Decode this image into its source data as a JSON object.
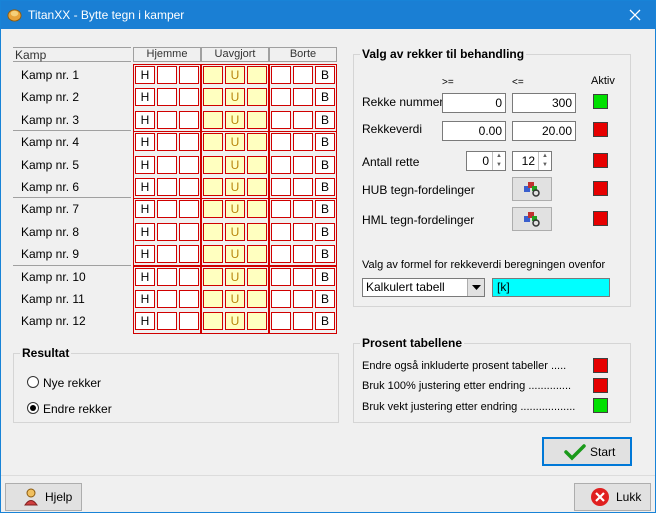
{
  "window": {
    "title": "TitanXX - Bytte tegn i kamper"
  },
  "grid": {
    "header_kamp": "Kamp",
    "groups": [
      "Hjemme",
      "Uavgjort",
      "Borte"
    ],
    "matches": [
      {
        "label": "Kamp nr. 1",
        "h": "H",
        "u": "U",
        "b": "B"
      },
      {
        "label": "Kamp nr. 2",
        "h": "H",
        "u": "U",
        "b": "B"
      },
      {
        "label": "Kamp nr. 3",
        "h": "H",
        "u": "U",
        "b": "B"
      },
      {
        "label": "Kamp nr. 4",
        "h": "H",
        "u": "U",
        "b": "B"
      },
      {
        "label": "Kamp nr. 5",
        "h": "H",
        "u": "U",
        "b": "B"
      },
      {
        "label": "Kamp nr. 6",
        "h": "H",
        "u": "U",
        "b": "B"
      },
      {
        "label": "Kamp nr. 7",
        "h": "H",
        "u": "U",
        "b": "B"
      },
      {
        "label": "Kamp nr. 8",
        "h": "H",
        "u": "U",
        "b": "B"
      },
      {
        "label": "Kamp nr. 9",
        "h": "H",
        "u": "U",
        "b": "B"
      },
      {
        "label": "Kamp nr. 10",
        "h": "H",
        "u": "U",
        "b": "B"
      },
      {
        "label": "Kamp nr. 11",
        "h": "H",
        "u": "U",
        "b": "B"
      },
      {
        "label": "Kamp nr. 12",
        "h": "H",
        "u": "U",
        "b": "B"
      }
    ]
  },
  "valg": {
    "title": "Valg av rekker til behandling",
    "col_ge": ">=",
    "col_le": "<=",
    "col_aktiv": "Aktiv",
    "rekke_nummer": {
      "label": "Rekke nummer",
      "min": "0",
      "max": "300"
    },
    "rekkeverdi": {
      "label": "Rekkeverdi",
      "min": "0.00",
      "max": "20.00"
    },
    "antall_rette": {
      "label": "Antall rette",
      "min": "0",
      "max": "12"
    },
    "hub": {
      "label": "HUB tegn-fordelinger"
    },
    "hml": {
      "label": "HML tegn-fordelinger"
    },
    "formel_label": "Valg av formel for rekkeverdi beregningen ovenfor",
    "formel_select": "Kalkulert tabell",
    "formel_value": "[k]",
    "indicators": {
      "rekke_nummer": "green",
      "rekkeverdi": "red",
      "antall_rette": "red",
      "hub": "red",
      "hml": "red"
    }
  },
  "resultat": {
    "title": "Resultat",
    "options": [
      "Nye rekker",
      "Endre rekker"
    ],
    "selected": "Endre rekker"
  },
  "prosent": {
    "title": "Prosent tabellene",
    "rows": [
      {
        "label": "Endre også inkluderte prosent tabeller .....",
        "state": "red"
      },
      {
        "label": "Bruk 100% justering etter endring ..............",
        "state": "red"
      },
      {
        "label": "Bruk vekt justering etter endring ..................",
        "state": "green"
      }
    ]
  },
  "buttons": {
    "start": "Start",
    "hjelp": "Hjelp",
    "lukk": "Lukk"
  },
  "colors": {
    "titlebar": "#1a7fd4",
    "cell_border": "#d00000",
    "draw_fill": "#ffffc0",
    "on": "#00e000",
    "off": "#e60000",
    "formula_bg": "#00ffff"
  }
}
